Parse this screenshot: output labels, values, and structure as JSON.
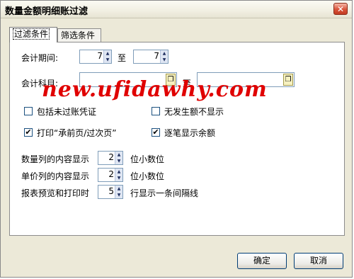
{
  "window": {
    "title": "数量金额明细账过滤",
    "close_glyph": "✕"
  },
  "tabs": [
    {
      "label": "过滤条件"
    },
    {
      "label": "筛选条件"
    }
  ],
  "period": {
    "label": "会计期间:",
    "from": "7",
    "to_label": "至",
    "to": "7"
  },
  "subject": {
    "label": "会计科目:",
    "from_value": "",
    "to_label": "至",
    "to_value": ""
  },
  "checkboxes": [
    {
      "label": "包括未过账凭证",
      "checked": false
    },
    {
      "label": "无发生额不显示",
      "checked": false
    },
    {
      "label": "打印“承前页/过次页”",
      "checked": true
    },
    {
      "label": "逐笔显示余额",
      "checked": true
    }
  ],
  "settings": [
    {
      "label": "数量列的内容显示",
      "value": "2",
      "suffix": "位小数位"
    },
    {
      "label": "单价列的内容显示",
      "value": "2",
      "suffix": "位小数位"
    },
    {
      "label": "报表预览和打印时",
      "value": "5",
      "suffix": "行显示一条间隔线"
    }
  ],
  "watermark": "new.ufidawhy.com",
  "buttons": {
    "ok": "确定",
    "cancel": "取消"
  },
  "glyphs": {
    "check": "✔",
    "up": "▲",
    "down": "▼",
    "pick": "❐"
  }
}
